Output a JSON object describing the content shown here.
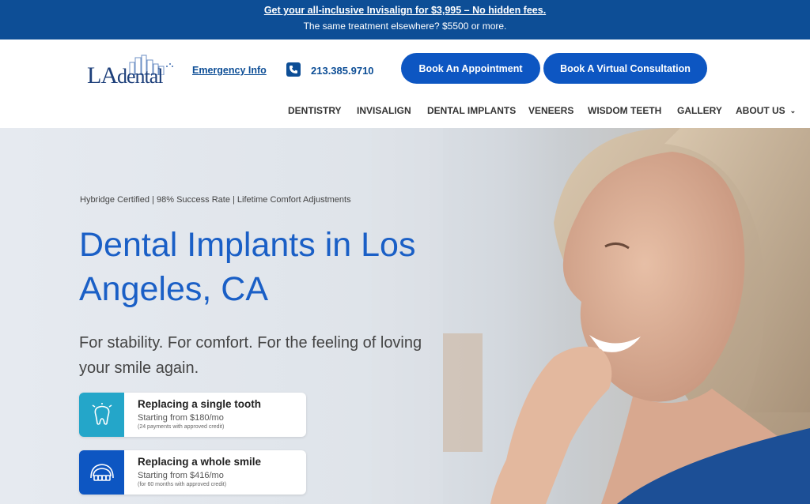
{
  "promo": {
    "headline": "Get your all-inclusive Invisalign for $3,995 – No hidden fees.",
    "subline": "The same treatment elsewhere? $5500 or more.",
    "bar_color": "#0d4e96"
  },
  "header": {
    "logo": {
      "text_la": "LA",
      "text_dental": "dental"
    },
    "emergency_link": "Emergency Info",
    "phone": "213.385.9710",
    "book_appointment": "Book An Appointment",
    "book_virtual": "Book A Virtual Consultation",
    "button_color": "#0d56c2"
  },
  "nav": {
    "items": [
      {
        "label": "DENTISTRY"
      },
      {
        "label": "INVISALIGN"
      },
      {
        "label": "DENTAL IMPLANTS"
      },
      {
        "label": "VENEERS"
      },
      {
        "label": "WISDOM TEETH"
      },
      {
        "label": "GALLERY"
      },
      {
        "label": "ABOUT US",
        "icon": "chevron-down-icon"
      }
    ]
  },
  "hero": {
    "certifications": "Hybridge Certified | 98% Success Rate | Lifetime Comfort Adjustments",
    "headline": "Dental Implants in Los Angeles, CA",
    "subheadline": "For stability. For comfort. For the feeling of loving your smile again.",
    "headline_color": "#1a5fc6",
    "cards": [
      {
        "title": "Replacing a single tooth",
        "price": "Starting from $180/mo",
        "note": "(24 payments with approved credit)",
        "icon": "tooth-icon",
        "icon_bg": "#24a6c9"
      },
      {
        "title": "Replacing a whole smile",
        "price": "Starting from $416/mo",
        "note": "(for 60 months with approved credit)",
        "icon": "full-arch-icon",
        "icon_bg": "#0d56c2"
      }
    ]
  }
}
